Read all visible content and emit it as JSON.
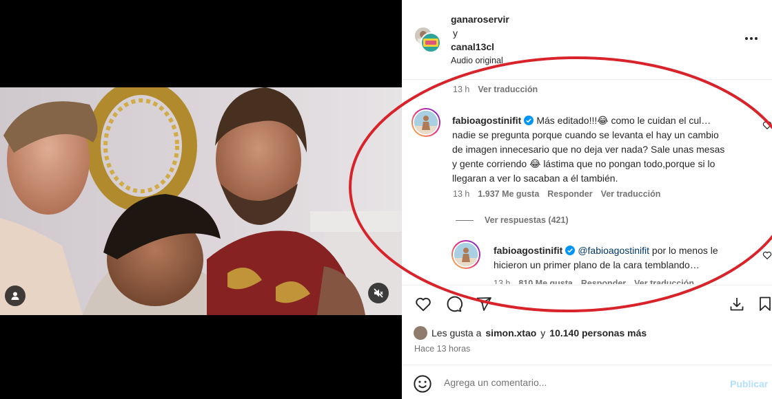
{
  "header": {
    "user1": "ganaroservir",
    "conjunction": "y",
    "user2": "canal13cl",
    "audio": "Audio original",
    "more_icon": "more-horizontal-icon"
  },
  "comments": {
    "prev_meta": {
      "time": "13 h",
      "translate": "Ver traducción"
    },
    "main": {
      "username": "fabioagostinifit",
      "lines": [
        "Más editado!!!😂 como le cuidan el cul…",
        "nadie se pregunta porque cuando se levanta el hay un cambio",
        "de imagen innecesario que no deja ver nada? Sale unas mesas",
        "y gente corriendo 😂 lástima que no pongan todo,porque si lo",
        "llegaran a ver lo sacaban a él también."
      ],
      "time": "13 h",
      "likes": "1.937 Me gusta",
      "reply": "Responder",
      "translate": "Ver traducción"
    },
    "view_replies": "Ver respuestas (421)",
    "reply": {
      "username": "fabioagostinifit",
      "mention": "@fabioagostinifit",
      "text_line1": " por lo menos le",
      "text_line2": "hicieron un primer plano de la cara temblando…",
      "time": "13 h",
      "likes": "810 Me gusta",
      "reply": "Responder",
      "translate": "Ver traducción"
    }
  },
  "actions": {
    "like_icon": "heart-icon",
    "comment_icon": "comment-icon",
    "share_icon": "send-icon",
    "download_icon": "download-icon",
    "save_icon": "bookmark-icon"
  },
  "likes_summary": {
    "prefix": "Les gusta a",
    "user": "simon.xtao",
    "middle": "y",
    "count": "10.140 personas más"
  },
  "timestamp": "Hace 13 horas",
  "composer": {
    "placeholder": "Agrega un comentario...",
    "publish": "Publicar"
  },
  "colors": {
    "annotation_ellipse": "#d9232a",
    "verified": "#0095f6",
    "publish_disabled": "#b2dffc"
  }
}
